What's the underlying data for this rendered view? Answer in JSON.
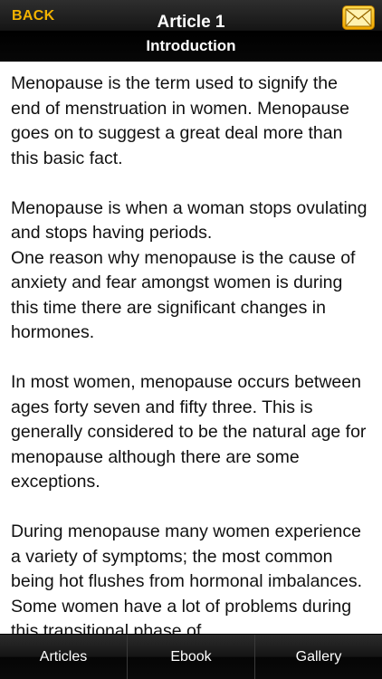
{
  "nav": {
    "back_label": "BACK",
    "title": "Article 1",
    "subtitle": "Introduction",
    "mail_icon": "envelope-icon"
  },
  "article": {
    "body": "Menopause is the term used to signify the end of menstruation in women. Menopause goes on to suggest a great deal more than this basic fact.\n\nMenopause is when a woman stops ovulating and stops having periods.\nOne reason why menopause is the cause of anxiety and fear amongst women is during this time there are significant changes in hormones.\n\nIn most women, menopause occurs between ages forty seven and fifty three. This is generally considered to be the natural age for menopause although there are some exceptions.\n\nDuring menopause many women experience a variety of symptoms; the most common being hot flushes from hormonal imbalances. Some women have a lot of problems during this transitional phase of"
  },
  "tabs": {
    "articles": "Articles",
    "ebook": "Ebook",
    "gallery": "Gallery"
  },
  "colors": {
    "accent": "#f2b200",
    "bar_dark": "#000000",
    "text": "#111111"
  }
}
